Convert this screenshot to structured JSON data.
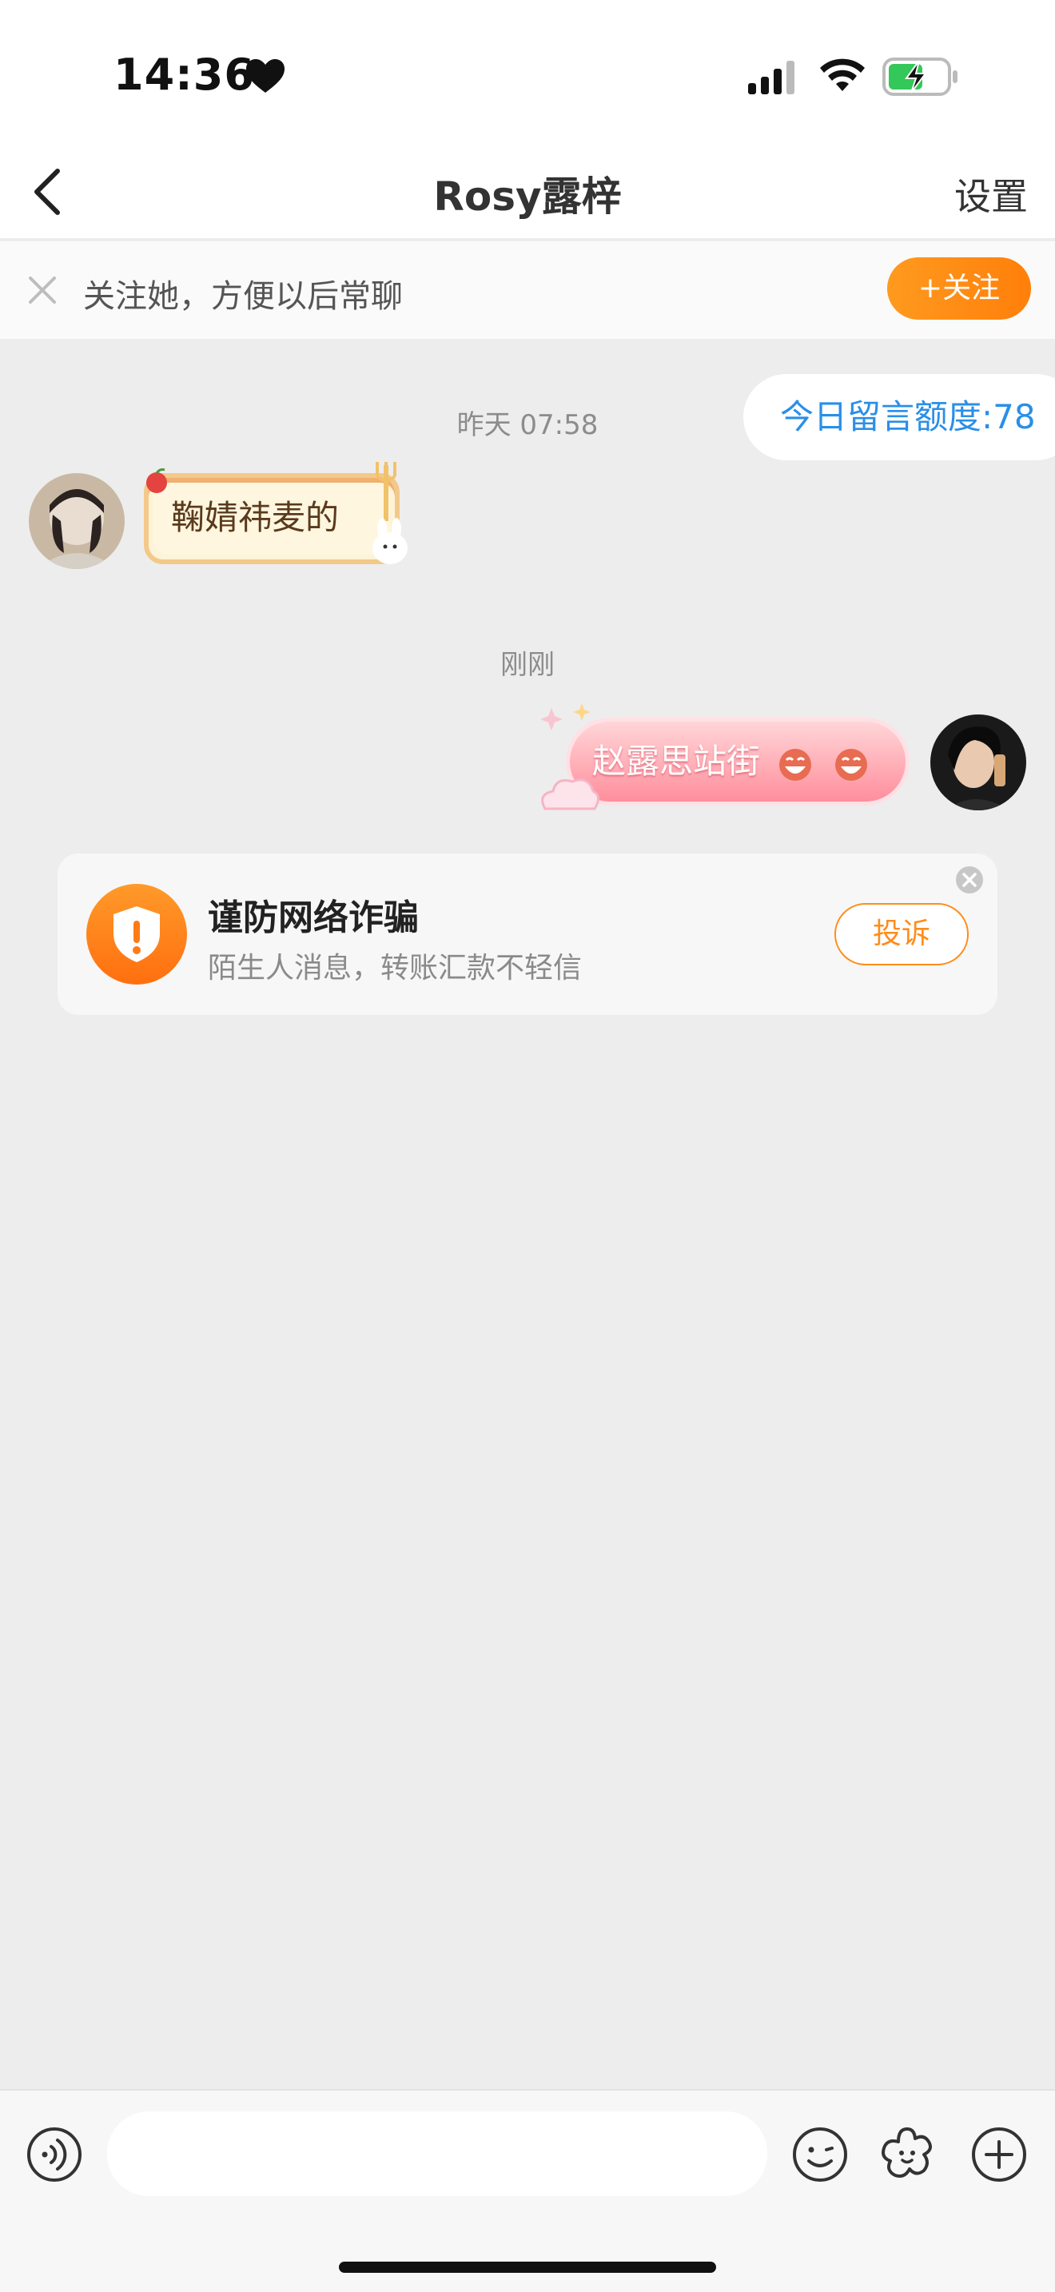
{
  "status_bar": {
    "time": "14:36"
  },
  "nav": {
    "title": "Rosy露梓",
    "settings_label": "设置"
  },
  "follow_banner": {
    "text": "关注她，方便以后常聊",
    "follow_button_label": "+关注"
  },
  "chat": {
    "quota_label": "今日留言额度:78",
    "timestamp_1": "昨天 07:58",
    "message_1": "鞠婧祎麦的",
    "timestamp_2": "刚刚",
    "message_2": "赵露思站街"
  },
  "warning": {
    "title": "谨防网络诈骗",
    "subtitle": "陌生人消息，转账汇款不轻信",
    "report_label": "投诉"
  },
  "input": {
    "placeholder": ""
  },
  "colors": {
    "accent_orange": "#ff8c1a",
    "link_blue": "#2a8fe8",
    "chat_background": "#ededed"
  },
  "icons": {
    "back": "chevron-left-icon",
    "close": "close-icon",
    "shield": "shield-warning-icon",
    "voice": "voice-icon",
    "emoji": "smiley-icon",
    "sticker": "flower-sticker-icon",
    "plus": "plus-icon"
  }
}
